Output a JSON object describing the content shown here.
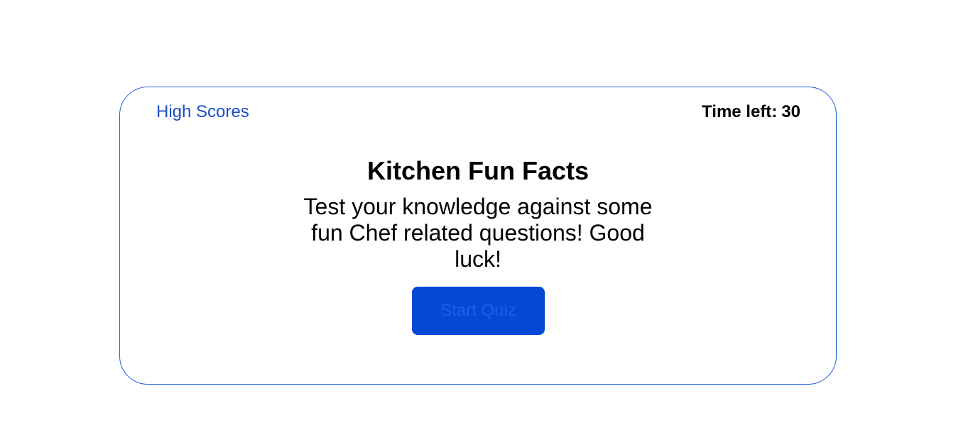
{
  "header": {
    "high_scores_label": "High Scores",
    "timer_label": "Time left:",
    "timer_value": "30"
  },
  "intro": {
    "title": "Kitchen Fun Facts",
    "description": "Test your knowledge against some fun Chef related questions! Good luck!"
  },
  "start_button": {
    "label": "Start Quiz"
  },
  "colors": {
    "accent": "#0648d6",
    "link": "#1a4fc4",
    "card_border": "#1f5fd6"
  }
}
